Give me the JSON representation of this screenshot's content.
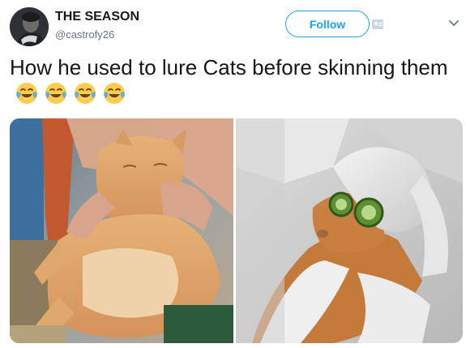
{
  "tweet": {
    "author_name": "THE SEASON",
    "author_handle": "@castrofy26",
    "follow_label": "Follow",
    "text": "How he used to lure Cats before skinning them",
    "emoji_icons": [
      "face-with-tears-of-joy-icon",
      "face-with-tears-of-joy-icon",
      "face-with-tears-of-joy-icon",
      "face-with-tears-of-joy-icon"
    ]
  },
  "colors": {
    "accent": "#1da1f2",
    "text": "#14171a",
    "muted": "#657786"
  },
  "media": [
    {
      "description_icon": "cat-being-petted-photo"
    },
    {
      "description_icon": "cat-spa-towel-cucumbers-photo"
    }
  ]
}
